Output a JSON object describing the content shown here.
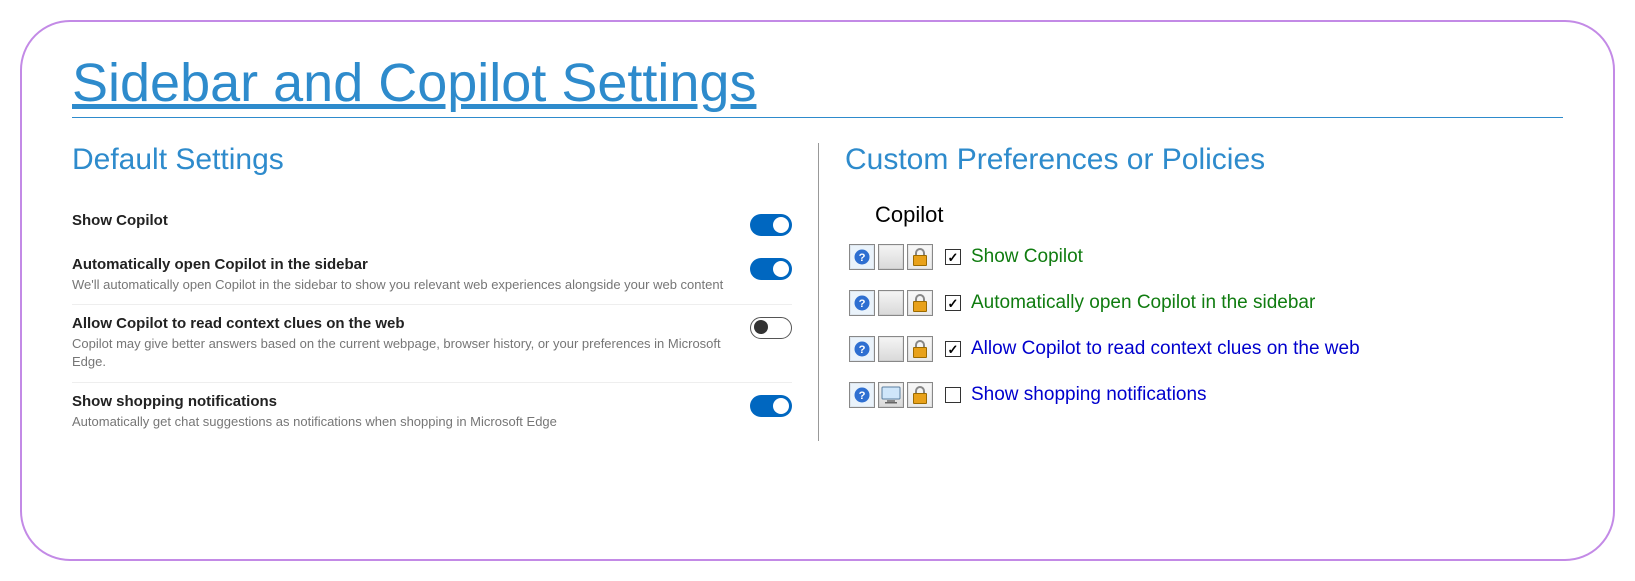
{
  "title": "Sidebar and Copilot Settings",
  "left": {
    "heading": "Default Settings",
    "settings": [
      {
        "label": "Show Copilot",
        "desc": "",
        "toggle": "on"
      },
      {
        "label": "Automatically open Copilot in the sidebar",
        "desc": "We'll automatically open Copilot in the sidebar to show you relevant web experiences alongside your web content",
        "toggle": "on"
      },
      {
        "label": "Allow Copilot to read context clues on the web",
        "desc": "Copilot may give better answers based on the current webpage, browser history, or your preferences in Microsoft Edge.",
        "toggle": "off"
      },
      {
        "label": "Show shopping notifications",
        "desc": "Automatically get chat suggestions as notifications when shopping in Microsoft Edge",
        "toggle": "on"
      }
    ]
  },
  "right": {
    "heading": "Custom Preferences or Policies",
    "group": "Copilot",
    "items": [
      {
        "label": "Show Copilot",
        "checked": true,
        "color": "green",
        "secondIcon": "blank"
      },
      {
        "label": "Automatically open Copilot in the sidebar",
        "checked": true,
        "color": "green",
        "secondIcon": "blank"
      },
      {
        "label": "Allow Copilot to read context clues on the web",
        "checked": true,
        "color": "blue",
        "secondIcon": "blank"
      },
      {
        "label": "Show shopping notifications",
        "checked": false,
        "color": "blue",
        "secondIcon": "computer"
      }
    ]
  }
}
